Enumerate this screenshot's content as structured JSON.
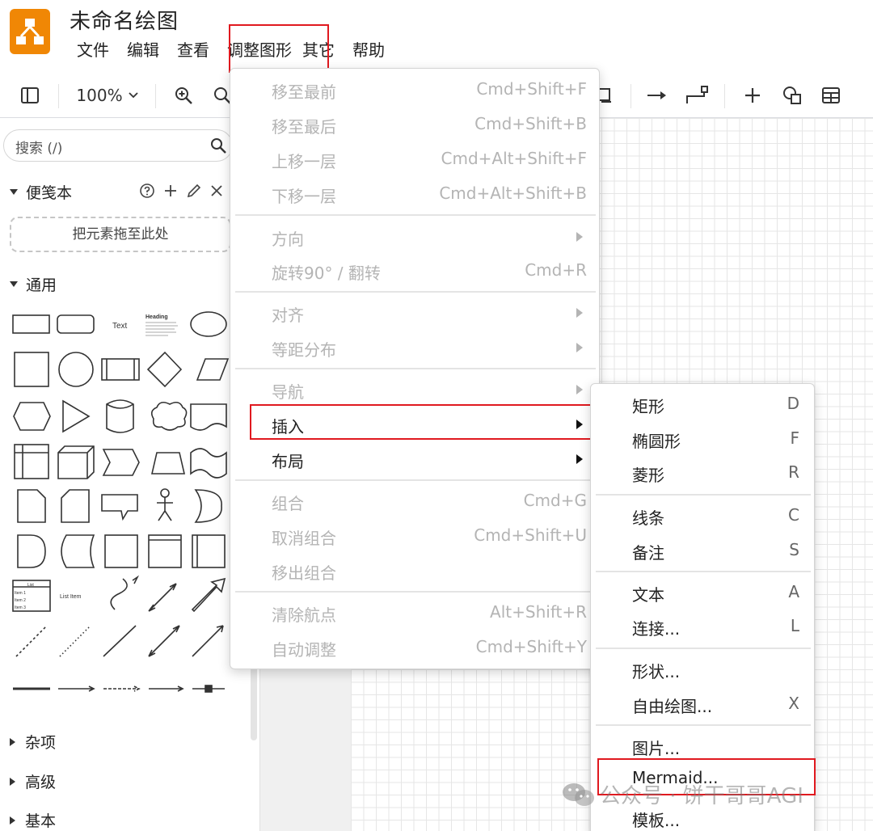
{
  "app": {
    "title": "未命名绘图"
  },
  "menubar": [
    "文件",
    "编辑",
    "查看",
    "调整图形",
    "其它",
    "帮助"
  ],
  "toolbar": {
    "zoom": "100%"
  },
  "sidebar": {
    "search_placeholder": "搜索 (/)",
    "scratchpad": {
      "title": "便笺本",
      "drop_hint": "把元素拖至此处"
    },
    "general": {
      "title": "通用"
    },
    "shape_text": {
      "text": "Text",
      "heading": "Heading",
      "list": "List",
      "list_item": "List Item",
      "item1": "Item 1",
      "item2": "Item 2",
      "item3": "Item 3"
    },
    "sections": [
      "杂项",
      "高级",
      "基本"
    ]
  },
  "arrange_menu": {
    "items": [
      {
        "label": "移至最前",
        "shortcut": "Cmd+Shift+F"
      },
      {
        "label": "移至最后",
        "shortcut": "Cmd+Shift+B"
      },
      {
        "label": "上移一层",
        "shortcut": "Cmd+Alt+Shift+F"
      },
      {
        "label": "下移一层",
        "shortcut": "Cmd+Alt+Shift+B"
      },
      {
        "label": "方向"
      },
      {
        "label": "旋转90° / 翻转",
        "shortcut": "Cmd+R"
      },
      {
        "label": "对齐"
      },
      {
        "label": "等距分布"
      },
      {
        "label": "导航"
      },
      {
        "label": "插入"
      },
      {
        "label": "布局"
      },
      {
        "label": "组合",
        "shortcut": "Cmd+G"
      },
      {
        "label": "取消组合",
        "shortcut": "Cmd+Shift+U"
      },
      {
        "label": "移出组合"
      },
      {
        "label": "清除航点",
        "shortcut": "Alt+Shift+R"
      },
      {
        "label": "自动调整",
        "shortcut": "Cmd+Shift+Y"
      }
    ]
  },
  "insert_menu": {
    "items": [
      {
        "label": "矩形",
        "shortcut": "D"
      },
      {
        "label": "椭圆形",
        "shortcut": "F"
      },
      {
        "label": "菱形",
        "shortcut": "R"
      },
      {
        "label": "线条",
        "shortcut": "C"
      },
      {
        "label": "备注",
        "shortcut": "S"
      },
      {
        "label": "文本",
        "shortcut": "A"
      },
      {
        "label": "连接...",
        "shortcut": "L"
      },
      {
        "label": "形状..."
      },
      {
        "label": "自由绘图...",
        "shortcut": "X"
      },
      {
        "label": "图片..."
      },
      {
        "label": "Mermaid..."
      },
      {
        "label": "模板..."
      }
    ]
  },
  "watermark": {
    "text": "公众号 · 饼干哥哥AGI"
  },
  "colors": {
    "accent": "#f08705",
    "highlight": "#e0191f"
  }
}
